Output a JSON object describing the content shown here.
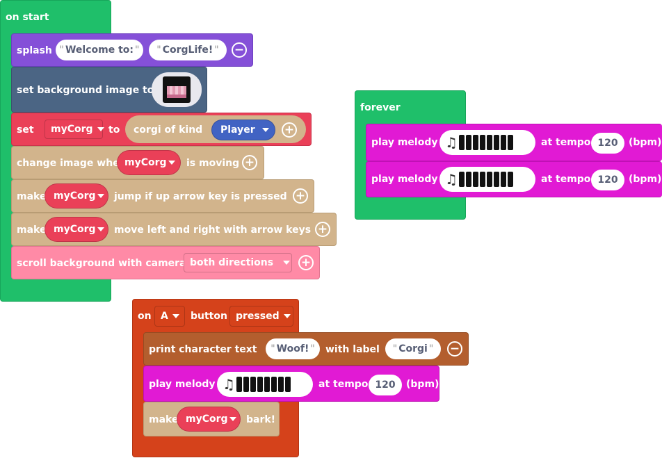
{
  "on_start": {
    "header": "on start",
    "splash": {
      "label": "splash",
      "arg1": "Welcome to:",
      "arg2": "CorgLife!"
    },
    "set_bg": {
      "label": "set background image to"
    },
    "set_var": {
      "label": "set",
      "var": "myCorg",
      "to": "to",
      "kind_label": "corgi of kind",
      "kind": "Player"
    },
    "change_image": {
      "label": "change image when",
      "var": "myCorg",
      "suffix": "is moving"
    },
    "make_jump": {
      "prefix": "make",
      "var": "myCorg",
      "suffix": "jump if up arrow key is pressed"
    },
    "make_move": {
      "prefix": "make",
      "var": "myCorg",
      "suffix": "move left and right with arrow keys"
    },
    "scroll": {
      "label": "scroll background with camera",
      "option": "both directions"
    }
  },
  "forever": {
    "header": "forever",
    "melody1": {
      "label": "play melody",
      "tempo_label": "at tempo",
      "tempo": "120",
      "unit": "(bpm)"
    },
    "melody2": {
      "label": "play melody",
      "tempo_label": "at tempo",
      "tempo": "120",
      "unit": "(bpm)"
    }
  },
  "on_button": {
    "on": "on",
    "button": "A",
    "button_label": "button",
    "event": "pressed",
    "print": {
      "label": "print character text",
      "text": "Woof!",
      "with_label": "with label",
      "label_value": "Corgi"
    },
    "melody": {
      "label": "play melody",
      "tempo_label": "at tempo",
      "tempo": "120",
      "unit": "(bpm)"
    },
    "bark": {
      "prefix": "make",
      "var": "myCorg",
      "suffix": "bark!"
    }
  },
  "colors": {
    "loops": "#1fbf6a",
    "sprites_purple": "#8550d8",
    "scene": "#4b6584",
    "variables": "#ea4058",
    "corgi": "#d2b48c",
    "scroll": "#ff8aa6",
    "music": "#e11ad4",
    "controller": "#d5421b",
    "print": "#b35e2e",
    "dropdown_blue": "#4163c3"
  },
  "icons": [
    "minus-icon",
    "plus-icon",
    "dropdown-arrow-icon",
    "music-note-icon",
    "background-image-thumbnail"
  ]
}
